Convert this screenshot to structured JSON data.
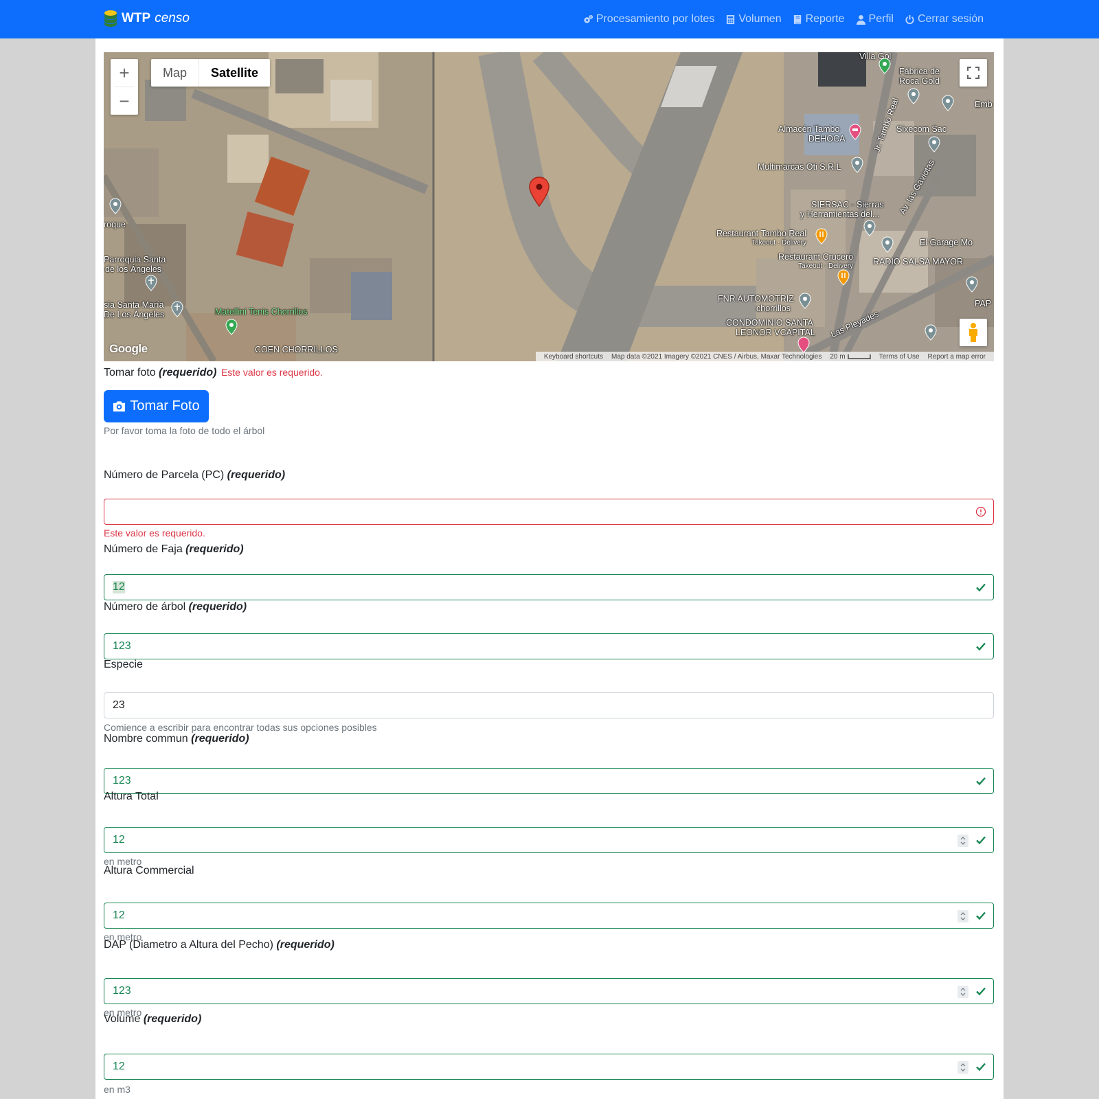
{
  "brand": {
    "name": "WTP",
    "sub": "censo"
  },
  "nav": [
    {
      "label": "Procesamiento por lotes",
      "icon": "gears-icon"
    },
    {
      "label": "Volumen",
      "icon": "calculator-icon"
    },
    {
      "label": "Reporte",
      "icon": "book-icon"
    },
    {
      "label": "Perfil",
      "icon": "user-icon"
    },
    {
      "label": "Cerrar sesión",
      "icon": "power-icon"
    }
  ],
  "map": {
    "type_map": "Map",
    "type_satellite": "Satellite",
    "google": "Google",
    "footer": {
      "shortcuts": "Keyboard shortcuts",
      "data": "Map data ©2021 Imagery ©2021 CNES / Airbus, Maxar Technologies",
      "scale": "20 m",
      "terms": "Terms of Use",
      "report": "Report a map error"
    },
    "labels": {
      "villa": "Villa Gol",
      "fabrica": "Fábrica de",
      "roca": "Roca Gold",
      "emb": "Emb",
      "almacen1": "Almacén Tambo",
      "almacen2": "DEHOCA",
      "tamboreal": "Jr. Tambo Real",
      "sixecom": "Sixecom Sac",
      "multimarcas": "Multimarcas Oti S.R.L",
      "gaviotas": "Av. las Gaviotas",
      "siersac1": "SIERSAC - Sierras",
      "siersac2": "y Herramientas del...",
      "tambo_rest": "Restaurant Tambo Real",
      "takeout1": "Takeout · Delivery",
      "garage": "El Garage Mo",
      "crucero": "Restaurant Crucero",
      "takeout2": "Takeout · Delivery",
      "radio": "RADIO SALSA MAYOR",
      "fnr1": "FNR AUTOMOTRIZ",
      "fnr2": "chorrillos",
      "pap": "PAP",
      "condo1": "CONDOMINIO SANTA",
      "condo2": "LEONOR VCAPITAL",
      "pleyades": "Las Pleyades",
      "roque": "roque",
      "parroquia1": "Parroquia Santa",
      "parroquia2": "de los Ángeles",
      "iglesia1": "sia Santa María",
      "iglesia2": "De Los Ángeles",
      "matellini": "Matellini Tenis Chorrillos",
      "coen": "COEN CHORRILLOS"
    }
  },
  "form": {
    "foto": {
      "label": "Tomar foto",
      "req": "(requerido)",
      "error": "Este valor es requerido.",
      "button": "Tomar Foto",
      "help": "Por favor toma la foto de todo el árbol"
    },
    "parcela": {
      "label": "Número de Parcela (PC)",
      "req": "(requerido)",
      "value": "",
      "error": "Este valor es requerido."
    },
    "faja": {
      "label": "Número de Faja",
      "req": "(requerido)",
      "value": "12"
    },
    "arbol": {
      "label": "Número de árbol",
      "req": "(requerido)",
      "value": "123"
    },
    "especie": {
      "label": "Especie",
      "value": "23",
      "help": "Comience a escribir para encontrar todas sus opciones posibles"
    },
    "nombre": {
      "label": "Nombre commun",
      "req": "(requerido)",
      "value": "123"
    },
    "altura_total": {
      "label": "Altura Total",
      "value": "12",
      "help": "en metro"
    },
    "altura_comm": {
      "label": "Altura Commercial",
      "value": "12",
      "help": "en metro"
    },
    "dap": {
      "label": "DAP (Diametro a Altura del Pecho)",
      "req": "(requerido)",
      "value": "123",
      "help": "en metro"
    },
    "volume": {
      "label": "Volume",
      "req": "(requerido)",
      "value": "12",
      "help": "en m3"
    }
  }
}
